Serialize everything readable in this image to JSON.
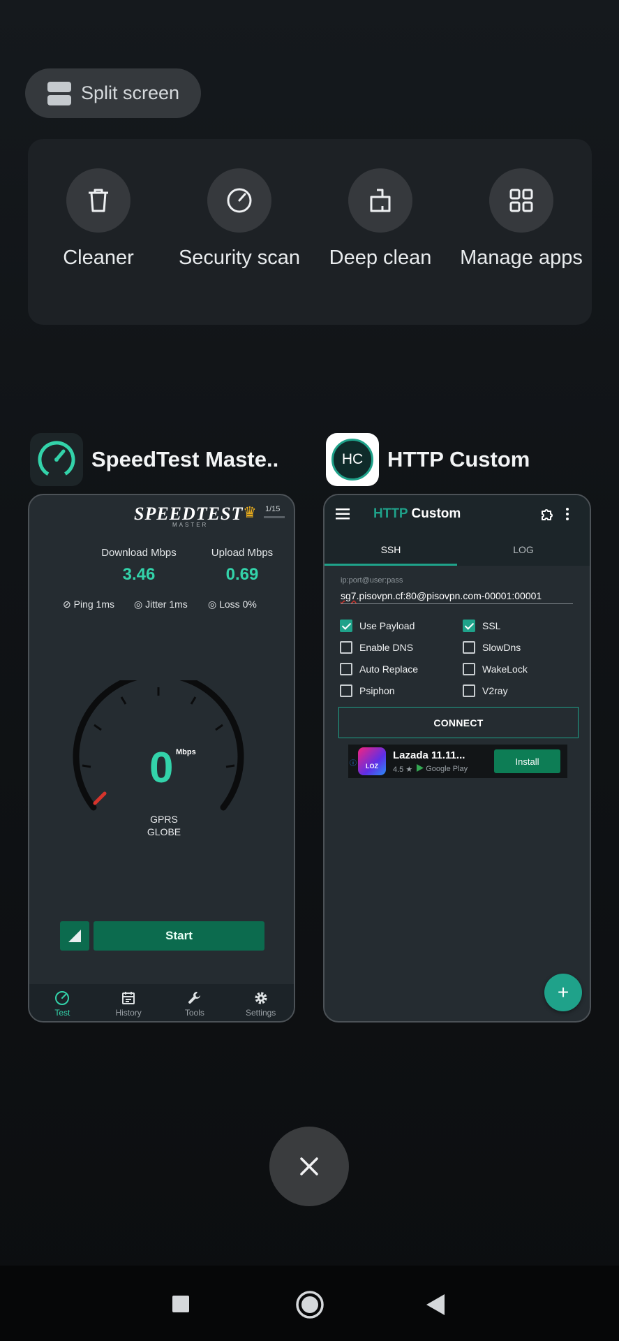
{
  "split_screen": {
    "label": "Split screen",
    "icon": "split-screen-icon"
  },
  "quick_tools": [
    {
      "label": "Cleaner",
      "icon": "trash-icon"
    },
    {
      "label": "Security scan",
      "icon": "gauge-icon"
    },
    {
      "label": "Deep clean",
      "icon": "broom-icon"
    },
    {
      "label": "Manage apps",
      "icon": "grid-icon"
    }
  ],
  "recent_apps": {
    "speedtest": {
      "title": "SpeedTest Maste..",
      "logo_text": "SPEEDTEST",
      "logo_sub": "MASTER",
      "page_counter": "1/15",
      "download_label": "Download Mbps",
      "download_value": "3.46",
      "upload_label": "Upload Mbps",
      "upload_value": "0.69",
      "ping": "Ping 1ms",
      "jitter": "Jitter 1ms",
      "loss": "Loss 0%",
      "gauge_value": "0",
      "gauge_unit": "Mbps",
      "network_type": "GPRS",
      "carrier": "GLOBE",
      "start_label": "Start",
      "nav": [
        {
          "label": "Test",
          "icon": "speedometer-icon",
          "active": true
        },
        {
          "label": "History",
          "icon": "calendar-icon",
          "active": false
        },
        {
          "label": "Tools",
          "icon": "wrench-icon",
          "active": false
        },
        {
          "label": "Settings",
          "icon": "gear-icon",
          "active": false
        }
      ],
      "accent_color": "#33d3aa"
    },
    "http_custom": {
      "title": "HTTP Custom",
      "app_title_accent": "HTTP",
      "app_title_rest": " Custom",
      "logo_text": "HC",
      "tabs": [
        "SSH",
        "LOG"
      ],
      "active_tab": "SSH",
      "input_hint": "ip:port@user:pass",
      "input_value_lead": "sg7",
      "input_value_rest": ".pisovpn.cf:80@pisovpn.com-00001:00001",
      "options": [
        {
          "label": "Use Payload",
          "checked": true
        },
        {
          "label": "SSL",
          "checked": true
        },
        {
          "label": "Enable DNS",
          "checked": false
        },
        {
          "label": "SlowDns",
          "checked": false
        },
        {
          "label": "Auto Replace",
          "checked": false
        },
        {
          "label": "WakeLock",
          "checked": false
        },
        {
          "label": "Psiphon",
          "checked": false
        },
        {
          "label": "V2ray",
          "checked": false
        }
      ],
      "connect_label": "CONNECT",
      "ad": {
        "title": "Lazada 11.11...",
        "icon_text": "LOZ",
        "rating": "4.5 ★",
        "store": "Google Play",
        "install_label": "Install"
      },
      "fab_label": "+",
      "accent_color": "#1fa28a"
    }
  },
  "close_all": {
    "icon": "close-icon"
  },
  "system_nav": [
    "recents-square-icon",
    "home-circle-icon",
    "back-triangle-icon"
  ]
}
